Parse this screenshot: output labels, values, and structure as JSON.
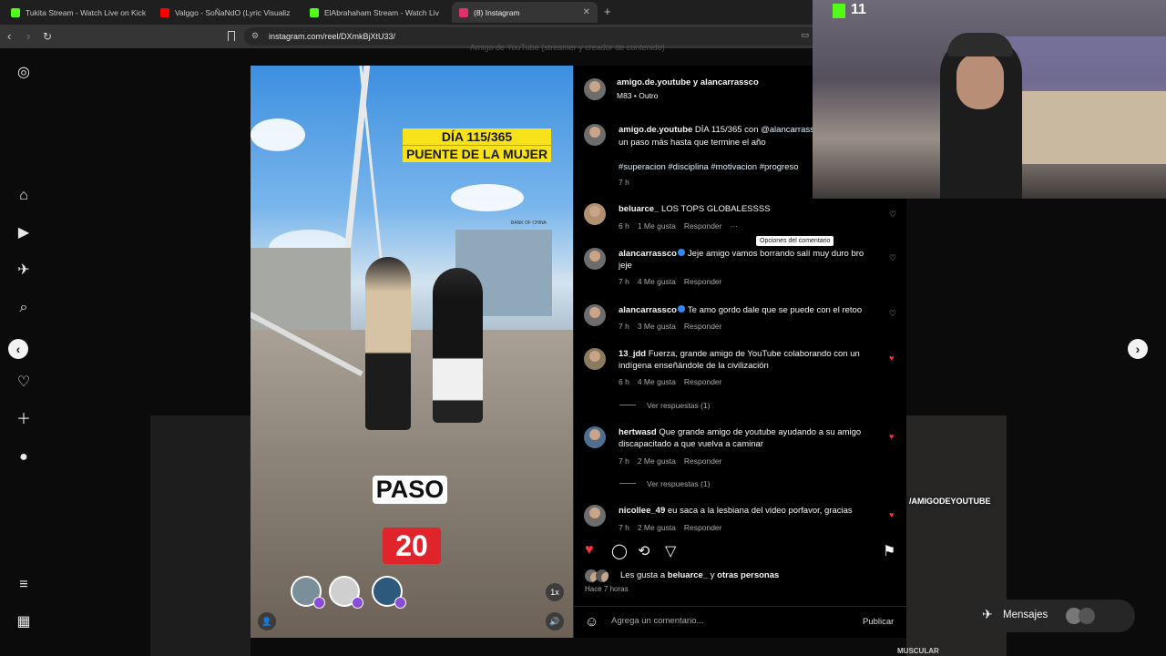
{
  "browser": {
    "tabs": [
      {
        "label": "Tukita Stream - Watch Live on Kick",
        "favicon_color": "#53fc18",
        "active": false
      },
      {
        "label": "Valggo - SoÑaNdO (Lyric Visualiz",
        "favicon_color": "#ff0000",
        "active": false
      },
      {
        "label": "ElAbrahaham Stream - Watch Liv",
        "favicon_color": "#53fc18",
        "active": false
      },
      {
        "label": "(8) Instagram",
        "favicon_color": "#e1306c",
        "active": true
      }
    ],
    "new_tab": "+",
    "url": "instagram.com/reel/DXmkBjXtU33/"
  },
  "reel": {
    "caption_line1": "DÍA 115/365",
    "caption_line2": "PUENTE DE LA MUJER",
    "sign_text": "BANK OF CHINA",
    "paso_label": "PASO",
    "paso_number": "20",
    "speed_label": "1x"
  },
  "post": {
    "header_users": "amigo.de.youtube y alancarrassco",
    "header_song": "M83 • Outro",
    "caption_user": "amigo.de.youtube",
    "caption_text": " DÍA 115/365 con ",
    "caption_mention": "@alancarrass",
    "caption_line2": "un paso más hasta que termine el año",
    "caption_tags": "#superacion #disciplina #motivacion #progreso",
    "caption_time": "7 h"
  },
  "comments": [
    {
      "user": "beluarce_",
      "text": " LOS TOPS GLOBALESSSS",
      "text2": "",
      "time": "6 h",
      "likes": "1 Me gusta",
      "reply": "Responder",
      "liked": false,
      "verified": false,
      "replies": ""
    },
    {
      "user": "alancarrassco",
      "text": "Jeje amigo vamos borrando salí muy duro bro",
      "text2": "jeje",
      "time": "7 h",
      "likes": "4 Me gusta",
      "reply": "Responder",
      "liked": false,
      "verified": true,
      "replies": ""
    },
    {
      "user": "alancarrassco",
      "text": "Te amo gordo dale que se puede con el retoo",
      "text2": "",
      "time": "7 h",
      "likes": "3 Me gusta",
      "reply": "Responder",
      "liked": false,
      "verified": true,
      "replies": ""
    },
    {
      "user": "13_jdd",
      "text": " Fuerza, grande amigo de YouTube colaborando con un",
      "text2": "indígena enseñándole de la civilización",
      "time": "6 h",
      "likes": "4 Me gusta",
      "reply": "Responder",
      "liked": true,
      "verified": false,
      "replies": "Ver respuestas (1)"
    },
    {
      "user": "hertwasd",
      "text": " Que grande amigo de youtube ayudando a su amigo",
      "text2": "discapacitado a que vuelva a caminar",
      "time": "7 h",
      "likes": "2 Me gusta",
      "reply": "Responder",
      "liked": true,
      "verified": false,
      "replies": "Ver respuestas (1)"
    },
    {
      "user": "nicollee_49",
      "text": " eu saca a la lesbiana del video porfavor, gracias",
      "text2": "",
      "time": "7 h",
      "likes": "2 Me gusta",
      "reply": "Responder",
      "liked": true,
      "verified": false,
      "replies": ""
    }
  ],
  "tooltip": "Opciones del comentario",
  "more_options": "···",
  "likes_line": {
    "prefix": "Les gusta a ",
    "user": "beluarce_",
    "middle": " y ",
    "others": "otras personas"
  },
  "posted_ago": "Hace 7 horas",
  "comment_box": {
    "placeholder": "Agrega un comentario...",
    "publish": "Publicar"
  },
  "messages": {
    "label": "Mensajes"
  },
  "webcam": {
    "viewer_count": "11"
  },
  "background_text": {
    "top": "Amigo de YouTube (streamer y creador de contenido)",
    "right_tag": "/AMIGODEYOUTUBE",
    "bottom_right": "MUSCULAR"
  },
  "colors": {
    "like_red": "#ff3040",
    "verified_blue": "#2f8bf5",
    "kick_green": "#53fc18",
    "number_red": "#e0242c",
    "caption_yellow": "#f7e21c"
  }
}
